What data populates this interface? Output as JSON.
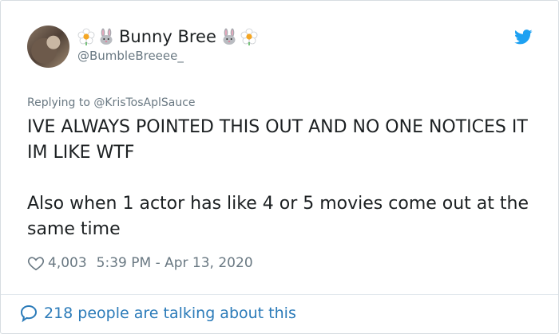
{
  "tweet": {
    "display_name": "Bunny Bree",
    "handle": "@BumbleBreeee_",
    "reply_to": "Replying to @KrisTosAplSauce",
    "text_lines": [
      "IVE ALWAYS POINTED THIS OUT AND NO ONE NOTICES IT IM LIKE WTF",
      "Also when 1 actor has like 4 or 5 movies come out at the same time"
    ],
    "like_count": "4,003",
    "timestamp": "5:39 PM - Apr 13, 2020",
    "footer_text": "218 people are talking about this"
  },
  "icons": {
    "name_emojis": [
      "blossom-icon",
      "rabbit-face-icon",
      "rabbit-face-icon",
      "blossom-icon"
    ],
    "brand": "twitter-bird-icon",
    "like": "heart-icon",
    "conversation": "speech-bubble-icon"
  },
  "colors": {
    "text": "#1c2022",
    "secondary": "#697882",
    "link": "#2b7bb9",
    "twitter_blue": "#1da1f2",
    "border": "#d7dde1"
  }
}
